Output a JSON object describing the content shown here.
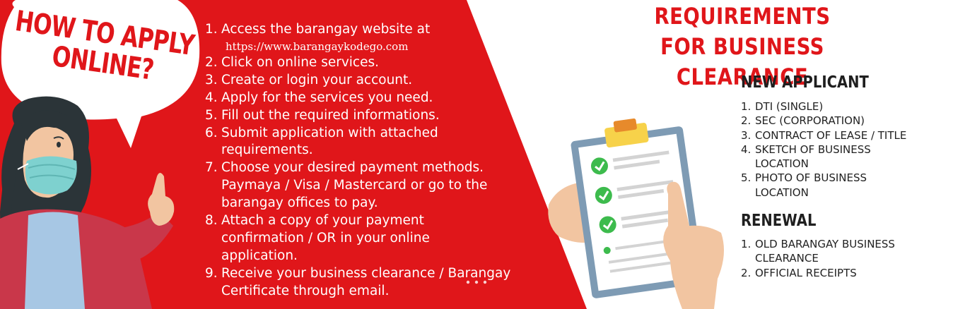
{
  "bubble": {
    "line1": "HOW TO APPLY",
    "line2": "ONLINE?"
  },
  "steps": [
    {
      "num": "1.",
      "text": "Access the barangay website at",
      "url": "https://www.barangaykodego.com"
    },
    {
      "num": "2.",
      "text": "Click on online services."
    },
    {
      "num": "3.",
      "text": "Create or login your account."
    },
    {
      "num": "4.",
      "text": "Apply for the services you need."
    },
    {
      "num": "5.",
      "text": "Fill out the required informations."
    },
    {
      "num": "6.",
      "text": "Submit application with attached requirements."
    },
    {
      "num": "7.",
      "text": "Choose your desired payment methods. Paymaya / Visa / Mastercard or go to the barangay offices to pay."
    },
    {
      "num": "8.",
      "text": "Attach a copy of your payment confirmation / OR in your online application."
    },
    {
      "num": "9.",
      "text": "Receive your business clearance / Barangay Certificate through email."
    }
  ],
  "requirements": {
    "title_line1": "REQUIREMENTS",
    "title_line2": "FOR BUSINESS CLEARANCE",
    "new_applicant": {
      "heading": "NEW APPLICANT",
      "items": [
        {
          "num": "1.",
          "text": "DTI (SINGLE)"
        },
        {
          "num": "2.",
          "text": "SEC (CORPORATION)"
        },
        {
          "num": "3.",
          "text": "CONTRACT OF LEASE / TITLE"
        },
        {
          "num": "4.",
          "text": "SKETCH OF BUSINESS LOCATION"
        },
        {
          "num": "5.",
          "text": "PHOTO OF BUSINESS LOCATION"
        }
      ]
    },
    "renewal": {
      "heading": "RENEWAL",
      "items": [
        {
          "num": "1.",
          "text": "OLD BARANGAY BUSINESS CLEARANCE"
        },
        {
          "num": "2.",
          "text": "OFFICIAL RECEIPTS"
        }
      ]
    }
  },
  "colors": {
    "brand_red": "#e0161a",
    "text_dark": "#1f1f1f",
    "check_green": "#3dbb4d",
    "clipboard_blue": "#7e9bb4"
  },
  "icons": [
    "speech-bubble",
    "woman-with-face-mask",
    "clipboard-checklist-icon",
    "check-icon",
    "pointing-hand"
  ]
}
